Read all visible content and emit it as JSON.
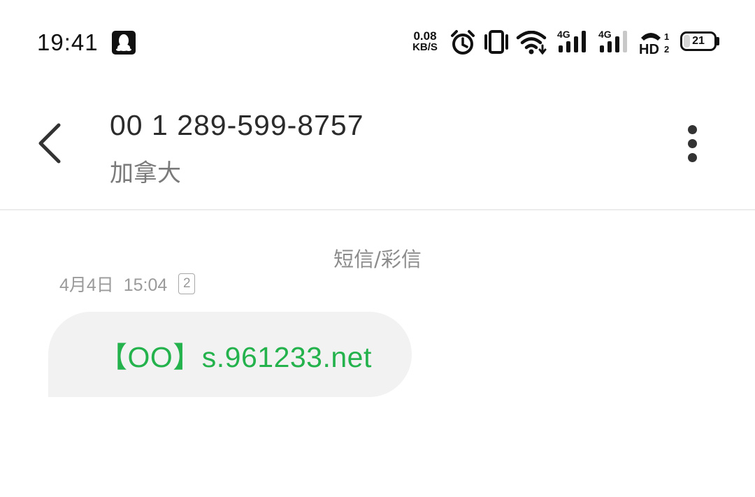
{
  "status_bar": {
    "time": "19:41",
    "network_speed_value": "0.08",
    "network_speed_unit": "KB/S",
    "sim1_network": "4G",
    "sim2_network": "4G",
    "hd_call": "HD",
    "battery_level": "21",
    "battery_fraction": 0.21,
    "icons": [
      "qq-icon",
      "alarm-icon",
      "vibrate-icon",
      "wifi-icon",
      "signal-4g-sim1-icon",
      "signal-4g-sim2-icon",
      "hd-call-icon",
      "battery-icon"
    ]
  },
  "header": {
    "back_icon": "chevron-left-icon",
    "contact_number": "00 1 289-599-8757",
    "contact_region": "加拿大",
    "more_icon": "more-vertical-icon"
  },
  "conversation": {
    "message_type": "短信/彩信",
    "messages": [
      {
        "time": "4月4日  15:04",
        "sim_slot": "2",
        "text": "【OO】s.961233.net",
        "text_color": "#24b24d",
        "bubble_color": "#f2f2f2"
      }
    ]
  }
}
